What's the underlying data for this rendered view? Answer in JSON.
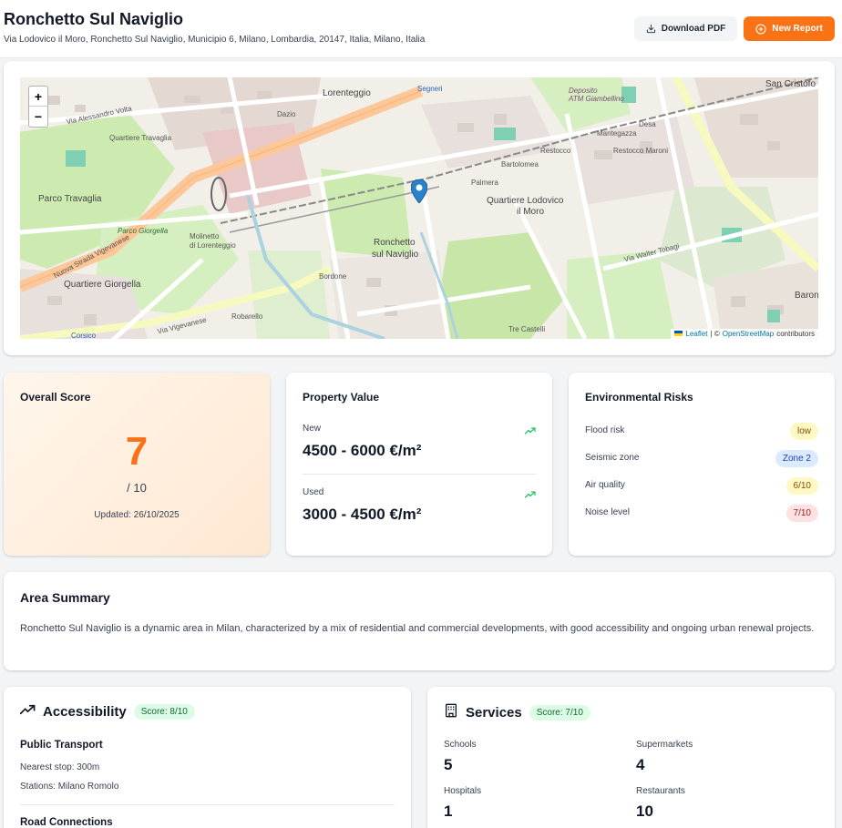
{
  "header": {
    "title": "Ronchetto Sul Naviglio",
    "address": "Via Lodovico il Moro, Ronchetto Sul Naviglio, Municipio 6, Milano, Lombardia, 20147, Italia, Milano, Italia",
    "download_label": "Download PDF",
    "new_report_label": "New Report",
    "accent_color": "#f97316"
  },
  "map": {
    "zoom_in": "+",
    "zoom_out": "−",
    "attribution_leaflet": "Leaflet",
    "attribution_sep": "| ©",
    "attribution_osm": "OpenStreetMap",
    "attribution_tail": "contributors",
    "labels": {
      "lorenteggio": "Lorenteggio",
      "segneri": "Segneri",
      "san_cristoforo": "San Cristofo",
      "deposito": "Deposito",
      "atm": "ATM Giambellino",
      "alessandro_volta": "Via Alessandro Volta",
      "quartiere_travaglia": "Quartiere Travaglia",
      "dazio": "Dazio",
      "mantegazza": "Mantegazza",
      "desa": "Desa",
      "restocco": "Restocco",
      "restocco_maroni": "Restocco Maroni",
      "bartolomea": "Bartolomea",
      "palmera": "Palmera",
      "quartiere_lodovico": "Quartiere Lodovico",
      "il_moro": "il Moro",
      "parco_travaglia": "Parco Travaglia",
      "parco_giorgella": "Parco Giorgella",
      "nuova_strada": "Nuova Strada Vigevanese",
      "molinetto": "Molinetto",
      "di_lorenteggio": "di Lorenteggio",
      "ronchetto": "Ronchetto",
      "sul_naviglio": "sul Naviglio",
      "via_walter_tobagi": "Via Walter Tobagi",
      "quartiere_giorgella": "Quartiere Giorgella",
      "bordone": "Bordone",
      "robarello": "Robarello",
      "tre_castelli": "Tre Castelli",
      "corsico": "Corsico",
      "via_vigevanese": "Via Vigevanese",
      "baron": "Baron"
    }
  },
  "score": {
    "title": "Overall Score",
    "value": "7",
    "out_of": "/ 10",
    "updated": "Updated: 26/10/2025"
  },
  "property": {
    "title": "Property Value",
    "new_label": "New",
    "new_value": "4500 - 6000 €/m²",
    "used_label": "Used",
    "used_value": "3000 - 4500 €/m²",
    "trend_color": "#22c55e"
  },
  "environment": {
    "title": "Environmental Risks",
    "rows": [
      {
        "label": "Flood risk",
        "value": "low"
      },
      {
        "label": "Seismic zone",
        "value": "Zone 2"
      },
      {
        "label": "Air quality",
        "value": "6/10"
      },
      {
        "label": "Noise level",
        "value": "7/10"
      }
    ]
  },
  "summary": {
    "title": "Area Summary",
    "text": "Ronchetto Sul Naviglio is a dynamic area in Milan, characterized by a mix of residential and commercial developments, with good accessibility and ongoing urban renewal projects."
  },
  "accessibility": {
    "title": "Accessibility",
    "score": "Score: 8/10",
    "public_transport_title": "Public Transport",
    "nearest_stop": "Nearest stop: 300m",
    "stations": "Stations: Milano Romolo",
    "road_title": "Road Connections"
  },
  "services": {
    "title": "Services",
    "score": "Score: 7/10",
    "items": [
      {
        "label": "Schools",
        "value": "5"
      },
      {
        "label": "Supermarkets",
        "value": "4"
      },
      {
        "label": "Hospitals",
        "value": "1"
      },
      {
        "label": "Restaurants",
        "value": "10"
      }
    ]
  }
}
